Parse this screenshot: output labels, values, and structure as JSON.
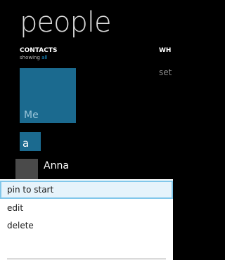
{
  "app": {
    "title": "people"
  },
  "pivot": {
    "section_header": "CONTACTS",
    "subtitle_prefix": "showing",
    "subtitle_link": "all",
    "next_section_peek": "WH",
    "next_section_body_peek": "set"
  },
  "tiles": {
    "me_label": "Me",
    "letter_group": "a"
  },
  "contacts": [
    {
      "name": "Anna"
    }
  ],
  "context_menu": {
    "items": [
      {
        "label": "pin to start",
        "highlighted": true
      },
      {
        "label": "edit",
        "highlighted": false
      },
      {
        "label": "delete",
        "highlighted": false
      }
    ]
  },
  "colors": {
    "background": "#000000",
    "accent_tile": "#1b6a8f",
    "accent_text": "#1ba1e2",
    "menu_background": "#ffffff",
    "menu_highlight_border": "#82c7ea",
    "menu_highlight_fill": "#e6f3fb"
  }
}
